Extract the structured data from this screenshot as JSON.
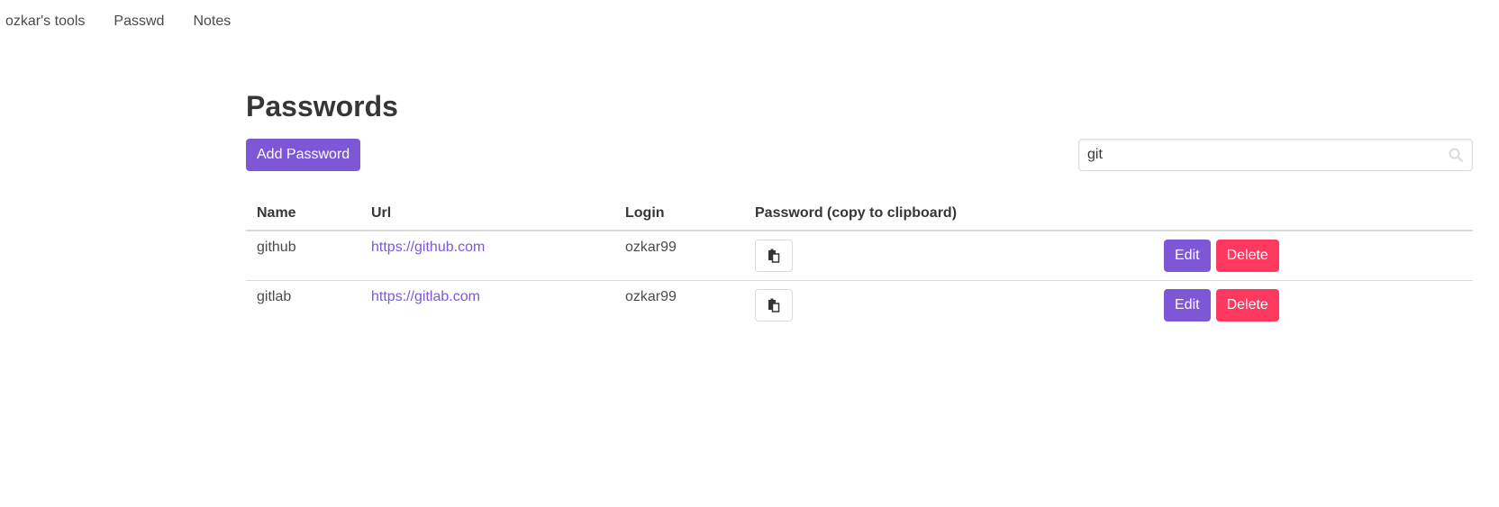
{
  "nav": {
    "brand": "ozkar's tools",
    "items": [
      {
        "label": "Passwd"
      },
      {
        "label": "Notes"
      }
    ]
  },
  "page": {
    "title": "Passwords",
    "add_button_label": "Add Password"
  },
  "search": {
    "value": "git",
    "icon": "search-icon"
  },
  "table": {
    "headers": {
      "name": "Name",
      "url": "Url",
      "login": "Login",
      "password": "Password (copy to clipboard)"
    },
    "rows": [
      {
        "name": "github",
        "url": "https://github.com",
        "login": "ozkar99",
        "edit_label": "Edit",
        "delete_label": "Delete"
      },
      {
        "name": "gitlab",
        "url": "https://gitlab.com",
        "login": "ozkar99",
        "edit_label": "Edit",
        "delete_label": "Delete"
      }
    ]
  },
  "colors": {
    "primary": "#7e57d6",
    "danger": "#ff3860",
    "link": "#7e57d6"
  }
}
